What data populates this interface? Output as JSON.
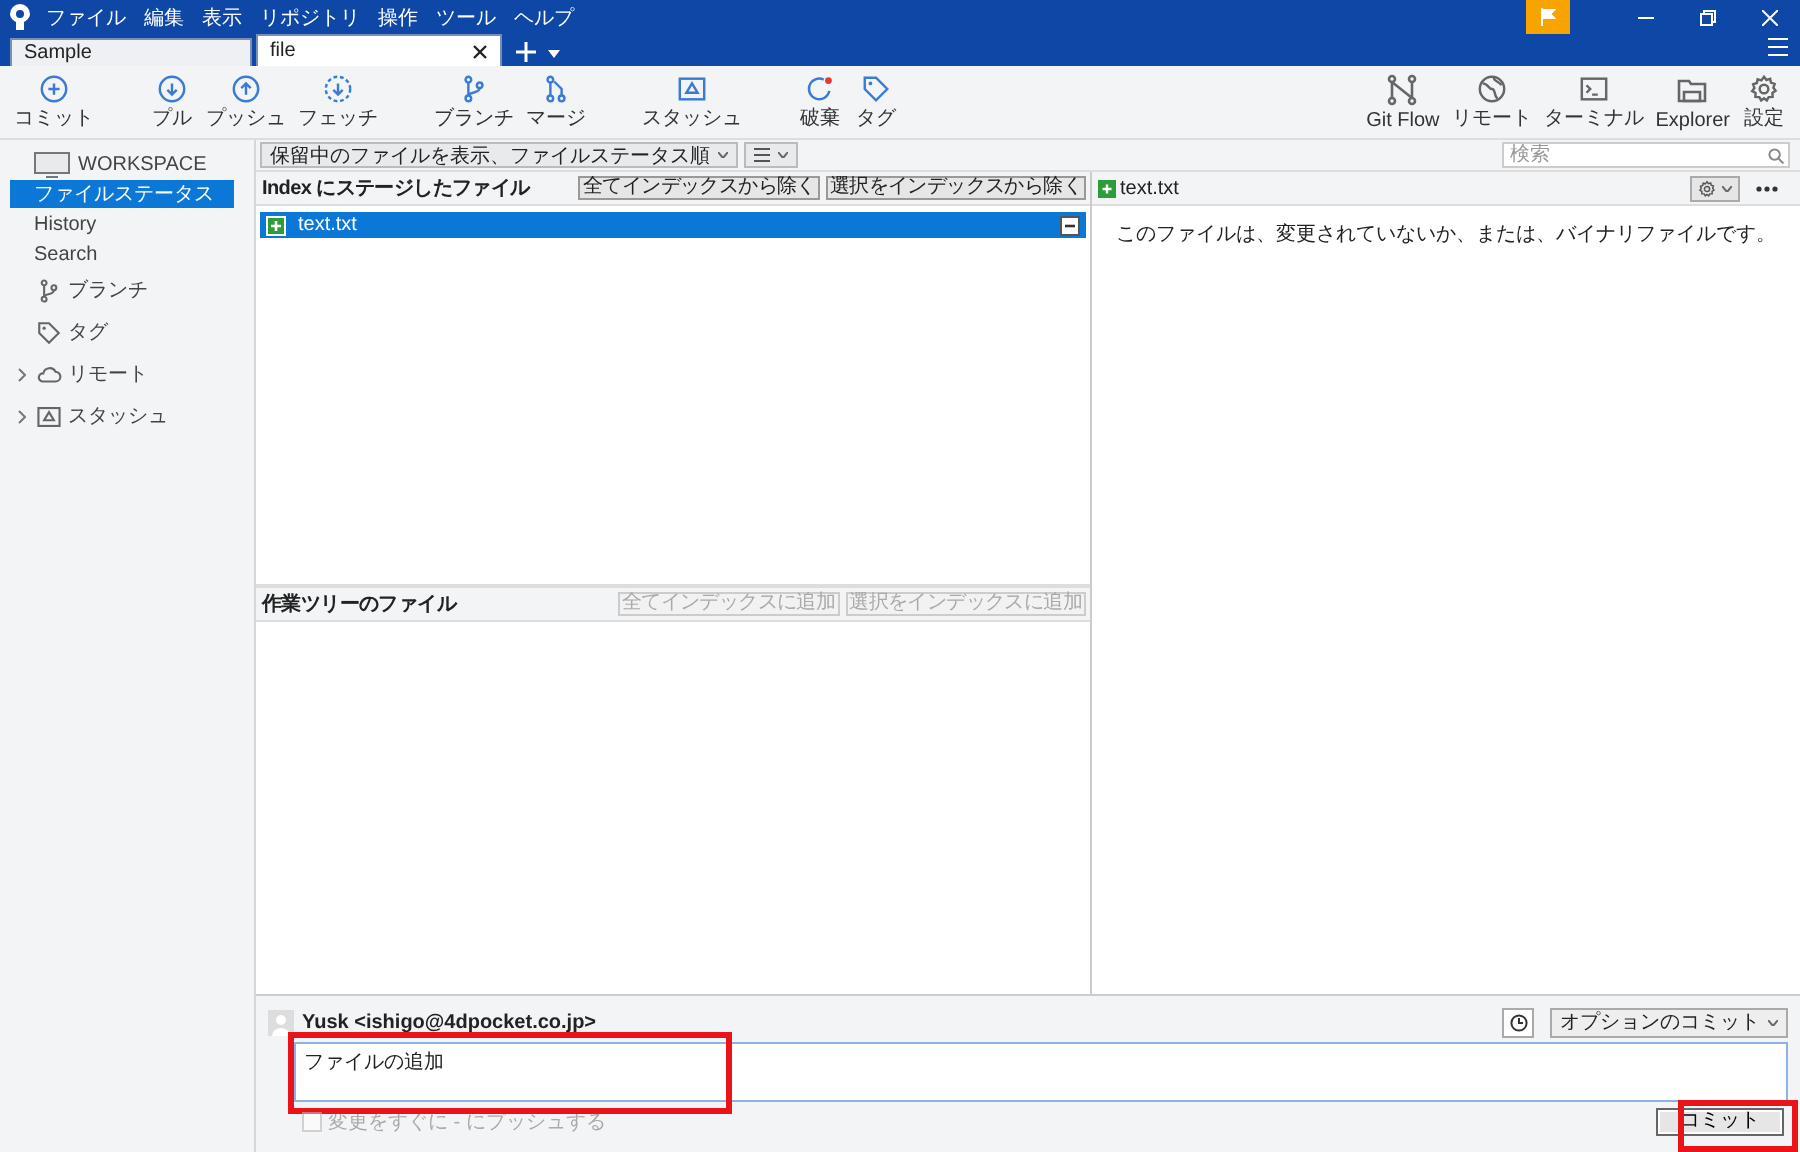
{
  "menu": [
    "ファイル",
    "編集",
    "表示",
    "リポジトリ",
    "操作",
    "ツール",
    "ヘルプ"
  ],
  "tabs": [
    {
      "label": "Sample",
      "selected": false
    },
    {
      "label": "file",
      "selected": true
    }
  ],
  "toolbar_left": [
    [
      {
        "label": "コミット",
        "kind": "plus"
      }
    ],
    [
      {
        "label": "プル",
        "kind": "down"
      },
      {
        "label": "プッシュ",
        "kind": "up"
      },
      {
        "label": "フェッチ",
        "kind": "fetch"
      }
    ],
    [
      {
        "label": "ブランチ",
        "kind": "branch"
      },
      {
        "label": "マージ",
        "kind": "merge"
      }
    ],
    [
      {
        "label": "スタッシュ",
        "kind": "stash"
      }
    ],
    [
      {
        "label": "破棄",
        "kind": "discard"
      },
      {
        "label": "タグ",
        "kind": "tag"
      }
    ]
  ],
  "toolbar_right": [
    {
      "label": "Git Flow",
      "kind": "flow"
    },
    {
      "label": "リモート",
      "kind": "globe"
    },
    {
      "label": "ターミナル",
      "kind": "terminal"
    },
    {
      "label": "Explorer",
      "kind": "folder"
    },
    {
      "label": "設定",
      "kind": "gear"
    }
  ],
  "sidebar": {
    "workspace": "WORKSPACE",
    "items": [
      {
        "label": "ファイルステータス",
        "selected": true
      },
      {
        "label": "History",
        "selected": false
      },
      {
        "label": "Search",
        "selected": false
      }
    ],
    "sections": [
      {
        "label": "ブランチ",
        "kind": "branch",
        "expandable": false
      },
      {
        "label": "タグ",
        "kind": "tag",
        "expandable": false
      },
      {
        "label": "リモート",
        "kind": "cloud",
        "expandable": true
      },
      {
        "label": "スタッシュ",
        "kind": "stash",
        "expandable": true
      }
    ]
  },
  "filter": {
    "label": "保留中のファイルを表示、ファイルステータス順"
  },
  "search": {
    "placeholder": "検索"
  },
  "staged": {
    "title": "Index にステージしたファイル",
    "buttons": [
      {
        "label": "全てインデックスから除く",
        "disabled": false
      },
      {
        "label": "選択をインデックスから除く",
        "disabled": false
      }
    ],
    "files": [
      {
        "name": "text.txt",
        "selected": true
      }
    ]
  },
  "unstaged": {
    "title": "作業ツリーのファイル",
    "buttons": [
      {
        "label": "全てインデックスに追加",
        "disabled": true
      },
      {
        "label": "選択をインデックスに追加",
        "disabled": true
      }
    ]
  },
  "diff": {
    "file": "text.txt",
    "message": "このファイルは、変更されていないか、または、バイナリファイルです。"
  },
  "commit": {
    "author": "Yusk <ishigo@4dpocket.co.jp>",
    "options": "オプションのコミット",
    "message": "ファイルの追加",
    "message_highlighted": true,
    "push_option": {
      "label": "変更をすぐに - にプッシュする",
      "checked": false,
      "disabled": true
    },
    "button": {
      "label": "コミット",
      "highlighted": true
    }
  }
}
